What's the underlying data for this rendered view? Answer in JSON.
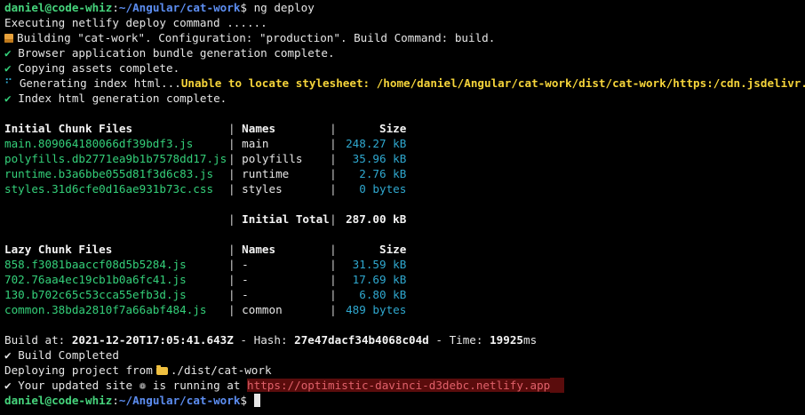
{
  "prompt": {
    "user_host": "daniel@code-whiz",
    "path": "~/Angular/cat-work",
    "symbol": "$"
  },
  "first_command": "ng deploy",
  "log": {
    "executing": "Executing netlify deploy command ......",
    "building": "Building \"cat-work\". Configuration: \"production\". Build Command: build.",
    "check_mark": "✔",
    "spinner_mark": "⠋",
    "bundle": "Browser application bundle generation complete.",
    "assets": "Copying assets complete.",
    "generating": "Generating index html...",
    "warning": "Unable to locate stylesheet: /home/daniel/Angular/cat-work/dist/cat-work/https:/cdn.jsdelivr.net/npm/bo",
    "index_complete": "Index html generation complete."
  },
  "initial_table": {
    "header": [
      "Initial Chunk Files",
      "Names",
      "Size"
    ],
    "rows": [
      {
        "file": "main.809064180066df39bdf3.js",
        "name": "main",
        "size": "248.27 kB"
      },
      {
        "file": "polyfills.db2771ea9b1b7578dd17.js",
        "name": "polyfills",
        "size": "35.96 kB"
      },
      {
        "file": "runtime.b3a6bbe055d81f3d6c83.js",
        "name": "runtime",
        "size": "2.76 kB"
      },
      {
        "file": "styles.31d6cfe0d16ae931b73c.css",
        "name": "styles",
        "size": "0 bytes"
      }
    ],
    "total_label": "Initial Total",
    "total_value": "287.00 kB"
  },
  "lazy_table": {
    "header": [
      "Lazy Chunk Files",
      "Names",
      "Size"
    ],
    "rows": [
      {
        "file": "858.f3081baaccf08d5b5284.js",
        "name": "-",
        "size": "31.59 kB"
      },
      {
        "file": "702.76aa4ec19cb1b0a6fc41.js",
        "name": "-",
        "size": "17.69 kB"
      },
      {
        "file": "130.b702c65c53cca55efb3d.js",
        "name": "-",
        "size": "6.80 kB"
      },
      {
        "file": "common.38bda2810f7a66abf484.js",
        "name": "common",
        "size": "489 bytes"
      }
    ]
  },
  "build_info": {
    "build_at_label": "Build at:",
    "build_at": "2021-12-20T17:05:41.643Z",
    "hash_label": "Hash:",
    "hash": "27e47dacf34b4068c04d",
    "time_label": "Time:",
    "time": "19925",
    "time_unit": "ms",
    "dash": "-"
  },
  "deploy": {
    "completed": "Build Completed",
    "deploying_prefix": "Deploying project from",
    "deploying_path": "./dist/cat-work",
    "site_prefix": "Your updated site",
    "site_mid": "is running at",
    "site_url": "https://optimistic-davinci-d3debc.netlify.app",
    "star_glyph": "❁"
  },
  "icons": {
    "package": "package-icon",
    "folder": "folder-icon",
    "globe": "globe-icon"
  }
}
